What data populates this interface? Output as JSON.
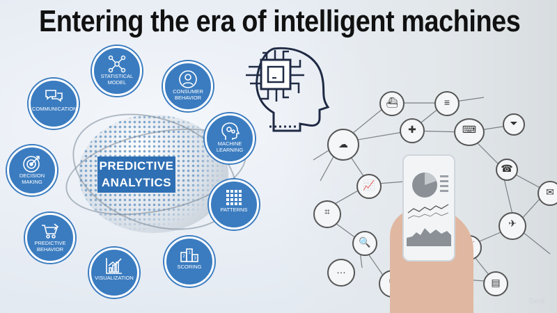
{
  "title": "Entering the era of intelligent machines",
  "center_label": [
    "PREDICTIVE",
    "ANALYTICS"
  ],
  "nodes": [
    {
      "label": "STATISTICAL MODEL",
      "icon": "network-icon"
    },
    {
      "label": "CONSUMER BEHAVIOR",
      "icon": "person-icon"
    },
    {
      "label": "COMMUNICATION",
      "icon": "speech-bubbles-icon"
    },
    {
      "label": "MACHINE LEARNING",
      "icon": "head-gears-icon"
    },
    {
      "label": "DECISION MAKING",
      "icon": "target-icon"
    },
    {
      "label": "PATTERNS",
      "icon": "grid-icon"
    },
    {
      "label": "PREDICTIVE BEHAVIOR",
      "icon": "cart-icon"
    },
    {
      "label": "VISUALIZATION",
      "icon": "bar-chart-icon"
    },
    {
      "label": "SCORING",
      "icon": "podium-icon"
    }
  ],
  "colors": {
    "node_blue": "#3b7cc0",
    "label_blue": "#2f6fb4"
  },
  "watermark": "Gerd"
}
